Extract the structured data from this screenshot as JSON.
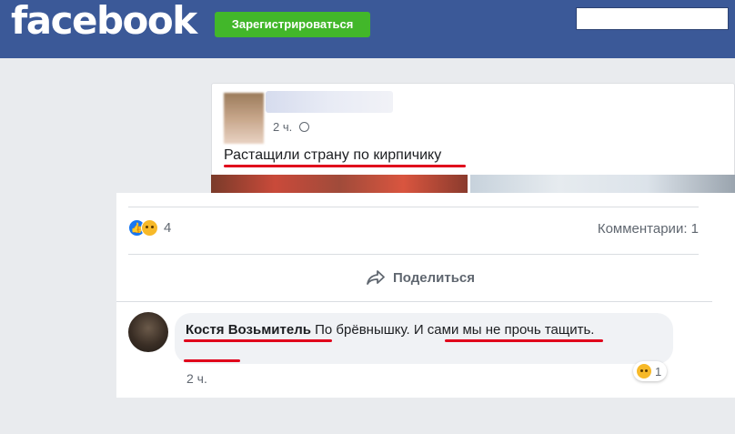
{
  "header": {
    "logo": "facebook",
    "signup_label": "Зарегистрироваться",
    "brand_color": "#3b5998",
    "signup_color": "#42b72a"
  },
  "post": {
    "time": "2 ч.",
    "privacy_icon": "globe-icon",
    "text": "Растащили страну по кирпичику",
    "reaction_count": "4",
    "comments_count": "Комментарии: 1",
    "share_label": "Поделиться"
  },
  "comment": {
    "author": "Костя Возьмитель",
    "text_part1": "По брёвнышку.",
    "text_part2": "И сами мы не прочь тащить.",
    "time": "2 ч.",
    "reaction_count": "1"
  },
  "annotation_color": "#e0001b"
}
